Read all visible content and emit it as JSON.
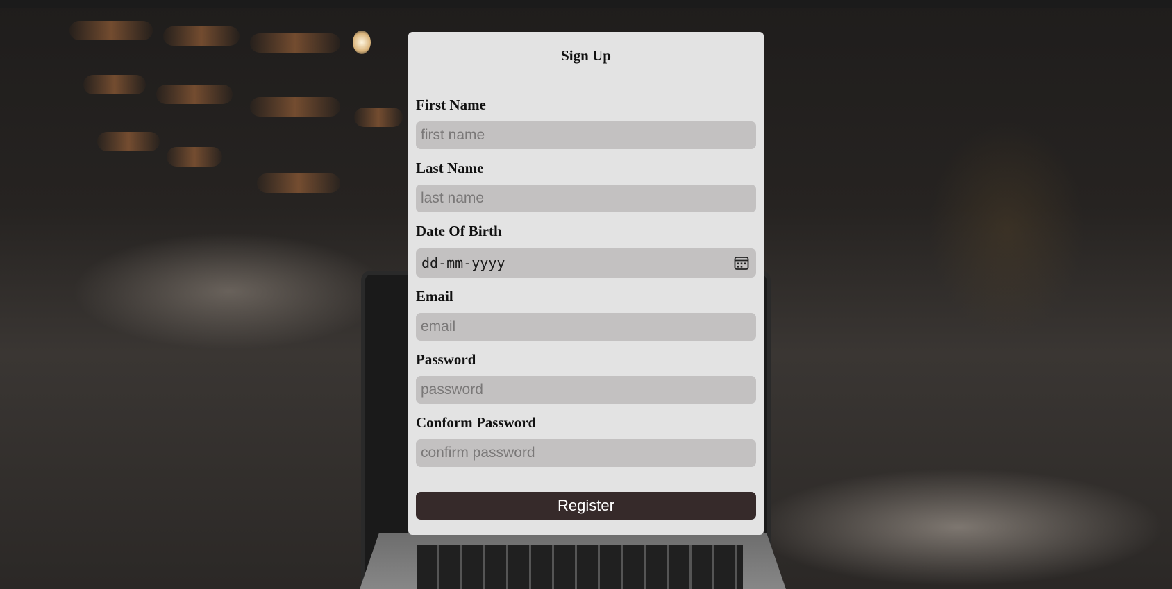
{
  "form": {
    "title": "Sign Up",
    "fields": [
      {
        "label": "First Name",
        "placeholder": "first name",
        "type": "text"
      },
      {
        "label": "Last Name",
        "placeholder": "last name",
        "type": "text"
      },
      {
        "label": "Date Of Birth",
        "placeholder": "dd-mm-yyyy",
        "type": "date"
      },
      {
        "label": "Email",
        "placeholder": "email",
        "type": "email"
      },
      {
        "label": "Password",
        "placeholder": "password",
        "type": "password"
      },
      {
        "label": "Conform Password",
        "placeholder": "confirm password",
        "type": "password"
      }
    ],
    "submit_label": "Register"
  },
  "icons": {
    "date_picker": "calendar-icon"
  },
  "colors": {
    "card_background": "#e3e3e3",
    "input_background": "#c3c1c1",
    "button_background": "#362a2a",
    "button_text": "#ffffff"
  }
}
